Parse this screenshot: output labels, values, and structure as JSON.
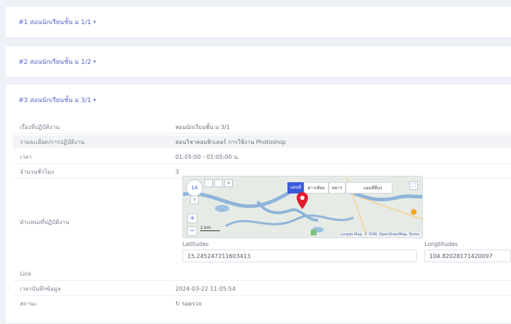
{
  "sections": [
    {
      "title": "#1 สอนนักเรียนชั้น ม 1/1"
    },
    {
      "title": "#2 สอนนักเรียนชั้น ม 1/2"
    },
    {
      "title": "#3 สอนนักเรียนชั้น ม 3/1"
    }
  ],
  "caret_glyph": "▾",
  "details": {
    "rows": [
      {
        "label": "เรื่องที่ปฏิบัติงาน",
        "value": "สอนนักเรียนชั้น ม 3/1"
      },
      {
        "label": "รายละเอียด/การปฏิบัติงาน",
        "value": "สอนวิชาคอมพิวเตอร์ การใช้งาน Photoshop"
      },
      {
        "label": "เวลา",
        "value": "01:05:00 - 01:05:00 น."
      },
      {
        "label": "จำนวนชั่วโมง",
        "value": "3"
      },
      {
        "label": "ตำแหน่งที่ปฏิบัติงาน",
        "value": ""
      },
      {
        "label": "Link",
        "value": ""
      },
      {
        "label": "เวลาบันทึกข้อมูล",
        "value": "2024-03-22 11:05:54"
      },
      {
        "label": "สถานะ",
        "value": "รอตรวจ"
      }
    ]
  },
  "map": {
    "type_buttons": [
      "แผนที่",
      "ดาวเทียม",
      "ทหาร",
      "แผนที่อื่นๆ"
    ],
    "zoom_level": "14",
    "scale_text": "2 km",
    "attribution": "Longdo Map, © OSM, OpenStreetMap, Terms"
  },
  "coords": {
    "lat_label": "Latitudes",
    "lat_value": "15.245247211603413",
    "lon_label": "Longtitudes",
    "lon_value": "104.82028171420097"
  },
  "colors": {
    "accent": "#5663c9",
    "status_pending": "#f0a020",
    "pin": "#e11d2e"
  }
}
